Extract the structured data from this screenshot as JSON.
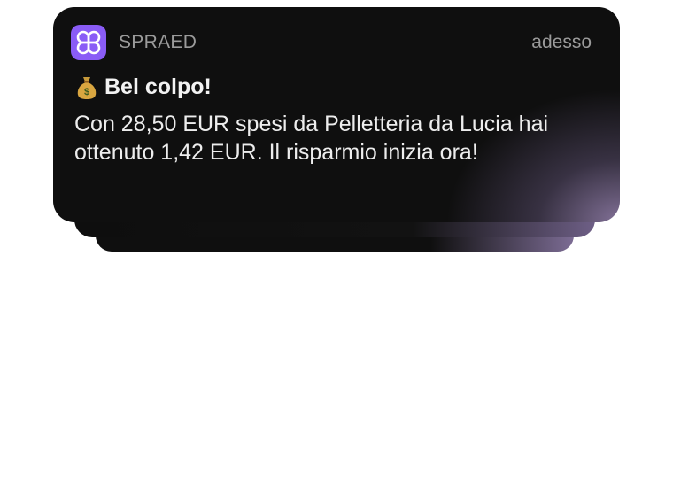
{
  "notification": {
    "app_name": "SPRAED",
    "time": "adesso",
    "title": "Bel colpo!",
    "emoji": "money-bag",
    "body": "Con 28,50 EUR spesi da Pelletteria da Lucia hai ottenuto 1,42 EUR. Il risparmio inizia ora!"
  },
  "colors": {
    "app_icon": "#8a5cf6",
    "card_background": "#0f0f0f",
    "accent_glow": "#9682af"
  }
}
